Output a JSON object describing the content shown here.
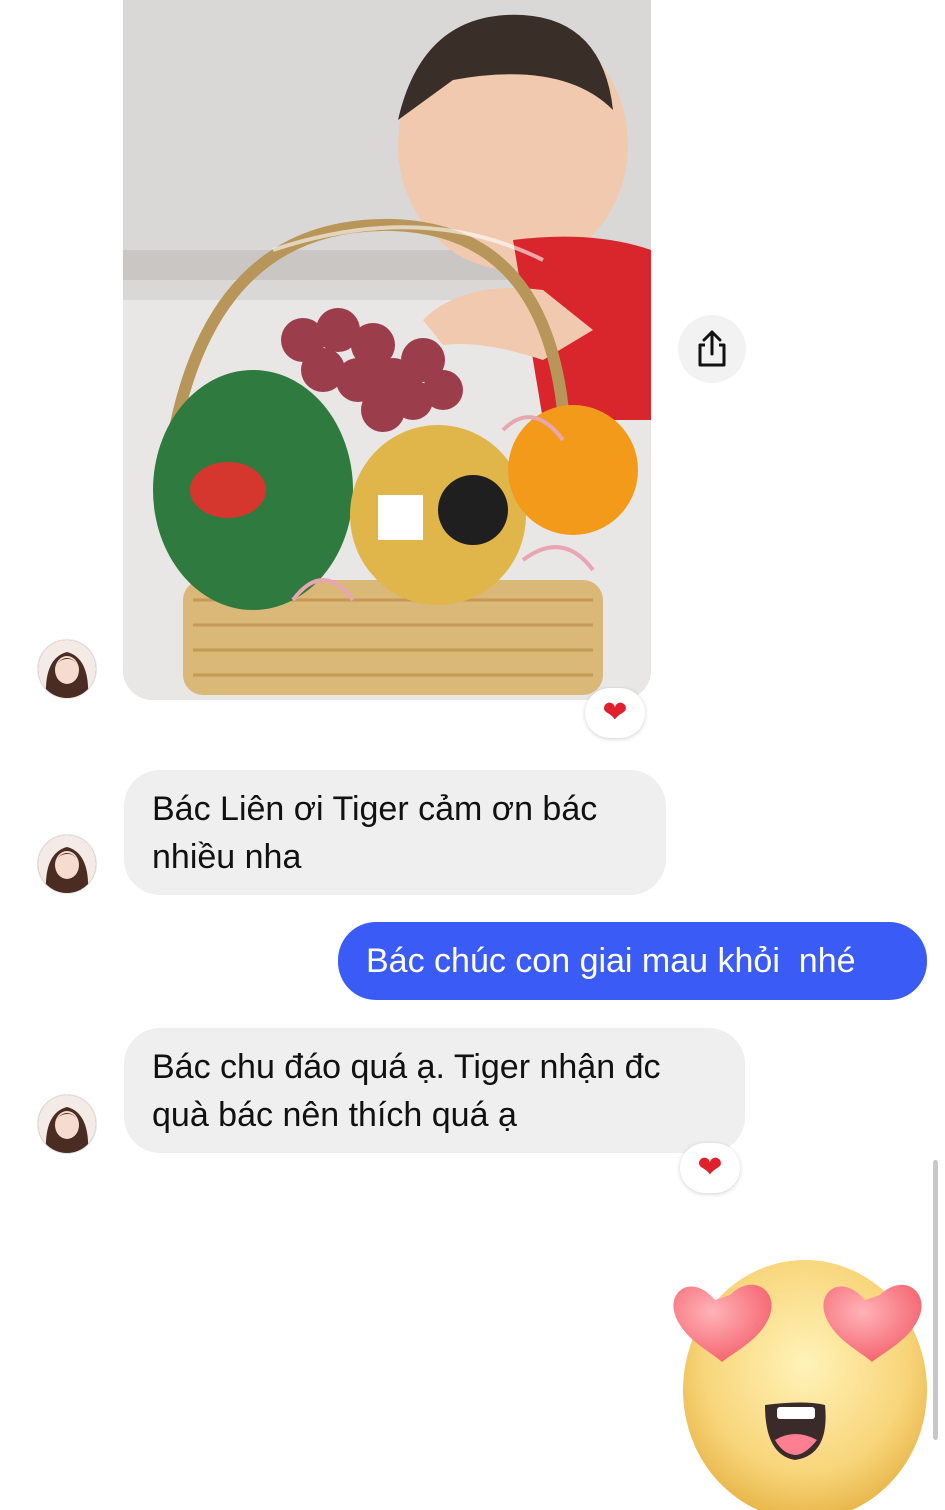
{
  "conversation": {
    "photo_message": {
      "image_name": "fruit-basket-photo",
      "reaction": "❤"
    },
    "messages": [
      {
        "direction": "incoming",
        "text": "Bác Liên ơi Tiger cảm ơn bác nhiều nha"
      },
      {
        "direction": "outgoing",
        "text": "Bác chúc con giai mau khỏi  nhé"
      },
      {
        "direction": "incoming",
        "text": "Bác chu đáo quá ạ. Tiger nhận đc quà bác nên thích quá ạ",
        "reaction": "❤"
      }
    ]
  },
  "icons": {
    "share": "share-icon",
    "heart": "heart-icon",
    "big_emoji": "heart-eyes-emoji-icon"
  },
  "colors": {
    "outgoing_bubble": "#3b5bf6",
    "incoming_bubble": "#efefef",
    "heart": "#e0202c"
  }
}
